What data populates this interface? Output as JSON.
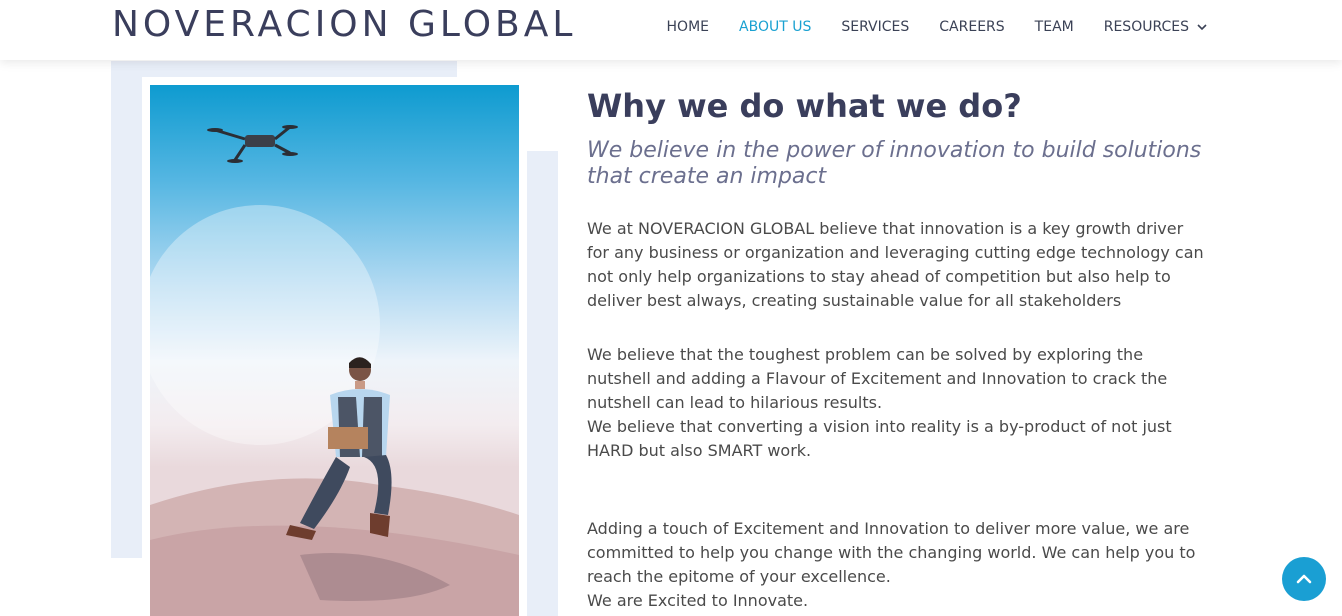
{
  "header": {
    "logo": "NOVERACION GLOBAL",
    "nav": [
      {
        "label": "HOME"
      },
      {
        "label": "ABOUT US"
      },
      {
        "label": "SERVICES"
      },
      {
        "label": "CAREERS"
      },
      {
        "label": "TEAM"
      },
      {
        "label": "RESOURCES"
      }
    ],
    "active_nav": "ABOUT US",
    "resources_icon": "chevron-down-icon"
  },
  "colors": {
    "brand_text": "#3a3e5c",
    "accent": "#1aa1d1",
    "panel": "#e8eef8"
  },
  "main": {
    "title": "Why we do what we do?",
    "subtitle": "We believe in the power of innovation to build solutions that create an impact",
    "paragraphs": [
      "We at NOVERACION GLOBAL believe that innovation is a key growth driver for any business or organization and leveraging cutting edge technology can not only help organizations to stay ahead of competition but also help to deliver best always, creating sustainable value for all stakeholders",
      "We believe that the toughest problem can be solved by exploring the nutshell and adding a Flavour of Excitement and Innovation to crack the nutshell can lead to hilarious results.",
      "We believe that converting a vision into reality is a by-product of not just HARD but also SMART work.",
      "Adding a touch of Excitement and Innovation to deliver more value, we are committed to help you change with the changing world. We can help you to reach the epitome of your excellence.",
      "We are Excited to Innovate."
    ]
  },
  "back_to_top_icon": "chevron-up-icon"
}
